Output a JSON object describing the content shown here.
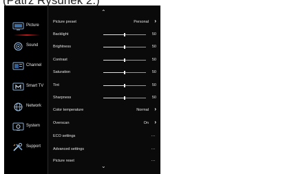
{
  "caption": "(Patrz Rysunek 2.)",
  "sidebar": {
    "items": [
      {
        "label": "Picture",
        "active": true
      },
      {
        "label": "Sound"
      },
      {
        "label": "Channel"
      },
      {
        "label": "Smart TV"
      },
      {
        "label": "Network"
      },
      {
        "label": "System"
      },
      {
        "label": "Support"
      }
    ]
  },
  "panel": {
    "rows": [
      {
        "label": "Picture preset",
        "value": "Personal",
        "kind": "arrow"
      },
      {
        "label": "Backlight",
        "value": "50",
        "kind": "slider",
        "level": 0.5
      },
      {
        "label": "Brightness",
        "value": "50",
        "kind": "slider",
        "level": 0.5
      },
      {
        "label": "Contrast",
        "value": "50",
        "kind": "slider",
        "level": 0.5
      },
      {
        "label": "Saturation",
        "value": "50",
        "kind": "slider",
        "level": 0.5
      },
      {
        "label": "Tint",
        "value": "50",
        "kind": "slider",
        "level": 0.5
      },
      {
        "label": "Sharpness",
        "value": "50",
        "kind": "slider",
        "level": 0.5
      },
      {
        "label": "Color temperature",
        "value": "Normal",
        "kind": "arrow"
      },
      {
        "label": "Overscan",
        "value": "On",
        "kind": "arrow"
      },
      {
        "label": "ECO settings",
        "value": "...",
        "kind": "more"
      },
      {
        "label": "Advanced settings",
        "value": "...",
        "kind": "more"
      },
      {
        "label": "Picture reset",
        "value": "...",
        "kind": "more"
      }
    ]
  },
  "colors": {
    "background": "#000000",
    "accent": "#c01818",
    "text": "#e6e6e6"
  }
}
